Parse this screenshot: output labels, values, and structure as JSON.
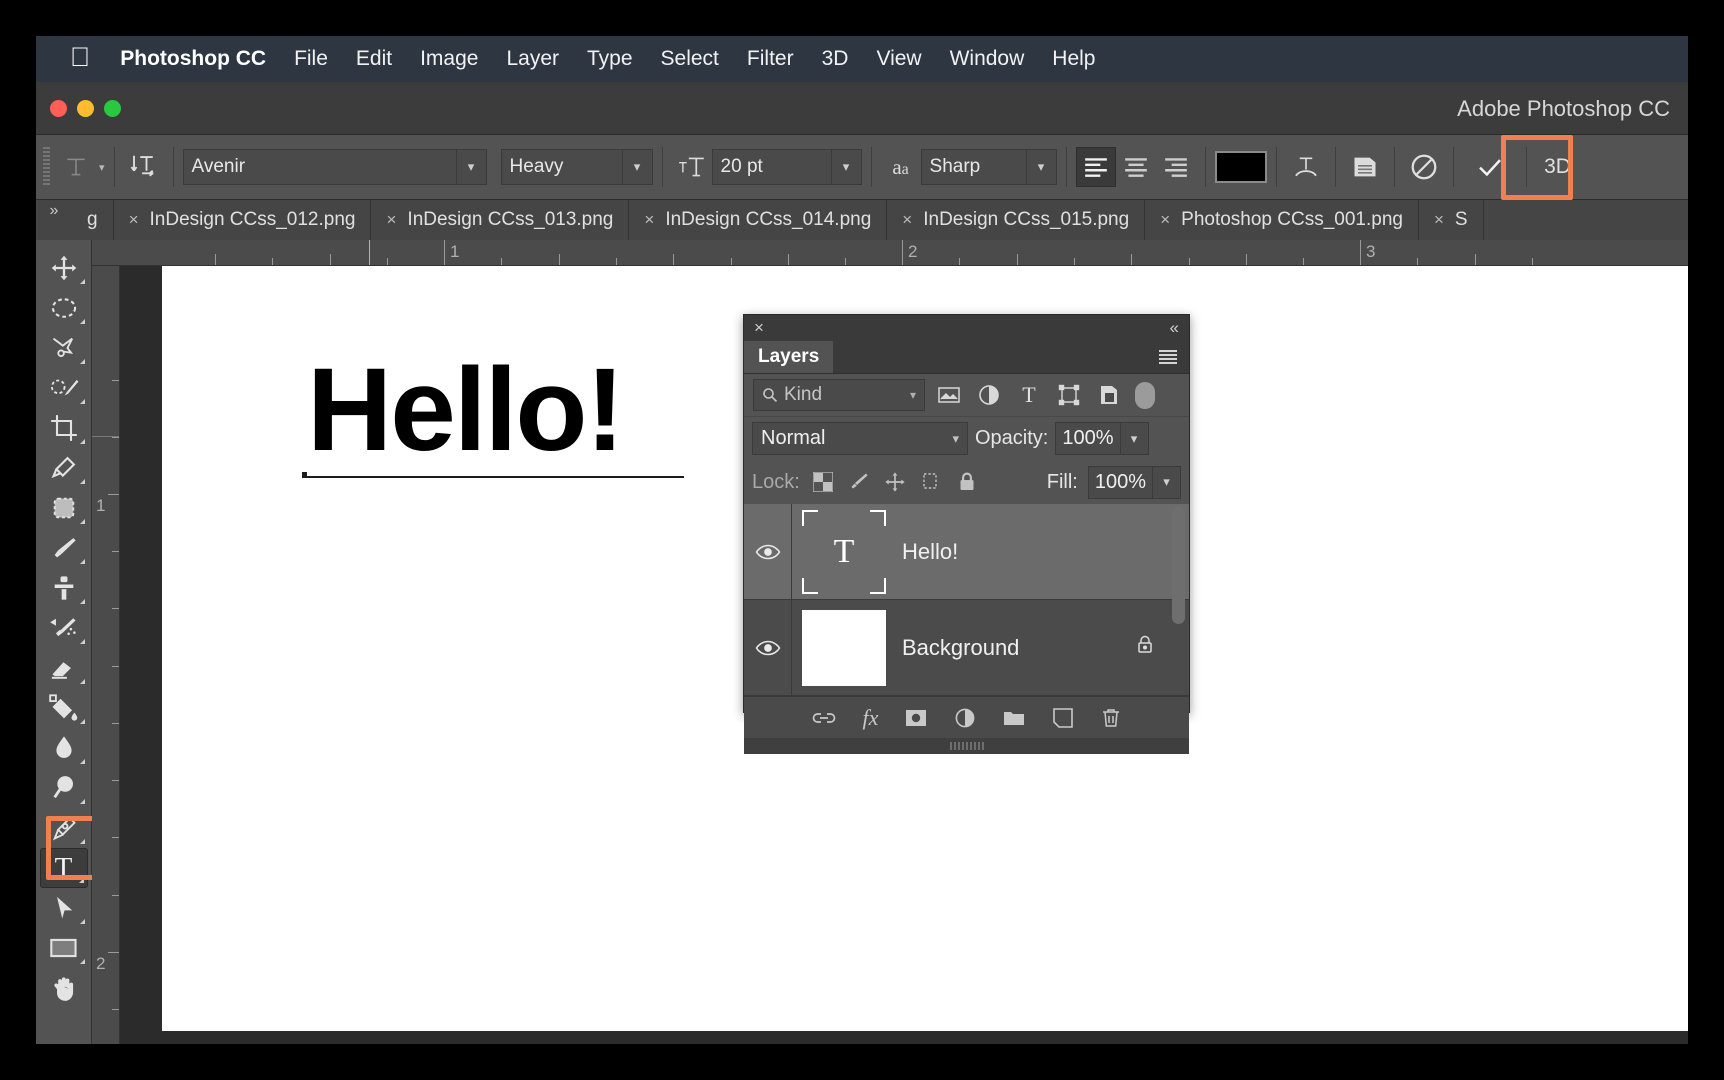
{
  "menubar": {
    "apple_icon": "apple-logo",
    "app_name": "Photoshop CC",
    "items": [
      "File",
      "Edit",
      "Image",
      "Layer",
      "Type",
      "Select",
      "Filter",
      "3D",
      "View",
      "Window",
      "Help"
    ]
  },
  "titlebar": {
    "document_title": "Adobe Photoshop CC"
  },
  "options_bar": {
    "tool_preset_icon": "text-tool-icon",
    "orientation_icon": "text-orientation-icon",
    "font_family": "Avenir",
    "font_style": "Heavy",
    "size_icon": "font-size-icon",
    "font_size": "20 pt",
    "antialias_icon": "anti-alias-icon",
    "antialias": "Sharp",
    "align_left_icon": "align-left-icon",
    "align_center_icon": "align-center-icon",
    "align_right_icon": "align-right-icon",
    "color_swatch": "#000000",
    "warp_icon": "warp-text-icon",
    "panel_icon": "character-panel-icon",
    "cancel_icon": "cancel-edit-icon",
    "commit_icon": "commit-edit-checkmark",
    "three_d_label": "3D",
    "highlight_color": "#f08050"
  },
  "tabs": {
    "overflow_icon": "chevron-double-right-icon",
    "items": [
      {
        "label": "g",
        "active": false,
        "truncated": true
      },
      {
        "label": "InDesign CCss_012.png",
        "active": false
      },
      {
        "label": "InDesign CCss_013.png",
        "active": false
      },
      {
        "label": "InDesign CCss_014.png",
        "active": false
      },
      {
        "label": "InDesign CCss_015.png",
        "active": false
      },
      {
        "label": "Photoshop CCss_001.png",
        "active": false
      },
      {
        "label": "S",
        "active": false,
        "truncated": true
      }
    ],
    "close_icon": "close-tab-icon"
  },
  "toolbar": {
    "tools": [
      {
        "name": "move-tool",
        "icon": "move-arrows-icon",
        "selected": false
      },
      {
        "name": "elliptical-marquee-tool",
        "icon": "ellipse-dashed-icon",
        "selected": false
      },
      {
        "name": "lasso-tool",
        "icon": "lasso-icon",
        "selected": false
      },
      {
        "name": "quick-selection-tool",
        "icon": "quick-select-icon",
        "selected": false
      },
      {
        "name": "crop-tool",
        "icon": "crop-icon",
        "selected": false
      },
      {
        "name": "eyedropper-tool",
        "icon": "eyedropper-icon",
        "selected": false
      },
      {
        "name": "patch-tool",
        "icon": "patch-icon",
        "selected": false
      },
      {
        "name": "brush-tool",
        "icon": "brush-icon",
        "selected": false
      },
      {
        "name": "clone-stamp-tool",
        "icon": "clone-stamp-icon",
        "selected": false
      },
      {
        "name": "history-brush-tool",
        "icon": "history-brush-icon",
        "selected": false
      },
      {
        "name": "eraser-tool",
        "icon": "eraser-icon",
        "selected": false
      },
      {
        "name": "paint-bucket-tool",
        "icon": "paint-bucket-icon",
        "selected": false
      },
      {
        "name": "blur-tool",
        "icon": "water-drop-icon",
        "selected": false
      },
      {
        "name": "dodge-tool",
        "icon": "dodge-icon",
        "selected": false
      },
      {
        "name": "pen-tool",
        "icon": "pen-icon",
        "selected": false
      },
      {
        "name": "type-tool",
        "icon": "type-T-icon",
        "selected": true
      },
      {
        "name": "path-selection-tool",
        "icon": "path-arrow-icon",
        "selected": false
      },
      {
        "name": "rectangle-tool",
        "icon": "rectangle-icon",
        "selected": false
      },
      {
        "name": "hand-tool",
        "icon": "hand-icon",
        "selected": false
      }
    ],
    "highlight_color": "#f08050"
  },
  "rulers": {
    "horizontal_marks": [
      "1",
      "2",
      "3"
    ],
    "vertical_marks": [
      "1",
      "2"
    ],
    "units": "inches"
  },
  "canvas": {
    "text_content": "Hello!",
    "text_color": "#000000",
    "background_color": "#ffffff"
  },
  "layers_panel": {
    "close_icon": "close-panel-icon",
    "collapse_icon": "collapse-panel-icon",
    "tab_title": "Layers",
    "menu_icon": "panel-menu-icon",
    "filter": {
      "search_icon": "search-icon",
      "kind_label": "Kind",
      "icons": [
        "image-filter-icon",
        "adjustment-filter-icon",
        "type-filter-icon",
        "shape-filter-icon",
        "smartobject-filter-icon"
      ],
      "toggle": "filter-toggle-switch"
    },
    "blend_mode": "Normal",
    "opacity_label": "Opacity:",
    "opacity_value": "100%",
    "lock_label": "Lock:",
    "lock_icons": [
      "lock-transparent-pixels-icon",
      "lock-image-pixels-icon",
      "lock-position-icon",
      "lock-artboard-icon",
      "lock-all-icon"
    ],
    "fill_label": "Fill:",
    "fill_value": "100%",
    "layers": [
      {
        "name": "Hello!",
        "visible": true,
        "selected": true,
        "thumbnail": "text-layer-thumbnail",
        "thumb_glyph": "T",
        "locked": false
      },
      {
        "name": "Background",
        "visible": true,
        "selected": false,
        "thumbnail": "white-background-thumbnail",
        "thumb_glyph": "",
        "locked": true
      }
    ],
    "eye_icon": "eye-visibility-icon",
    "layer_lock_icon": "lock-icon",
    "bottom_icons": [
      {
        "name": "link-layers-button",
        "icon": "link-icon"
      },
      {
        "name": "layer-style-button",
        "icon": "fx-icon"
      },
      {
        "name": "layer-mask-button",
        "icon": "mask-icon"
      },
      {
        "name": "adjustment-layer-button",
        "icon": "half-circle-icon"
      },
      {
        "name": "new-group-button",
        "icon": "folder-icon"
      },
      {
        "name": "new-layer-button",
        "icon": "new-layer-icon"
      },
      {
        "name": "delete-layer-button",
        "icon": "trash-icon"
      }
    ]
  }
}
